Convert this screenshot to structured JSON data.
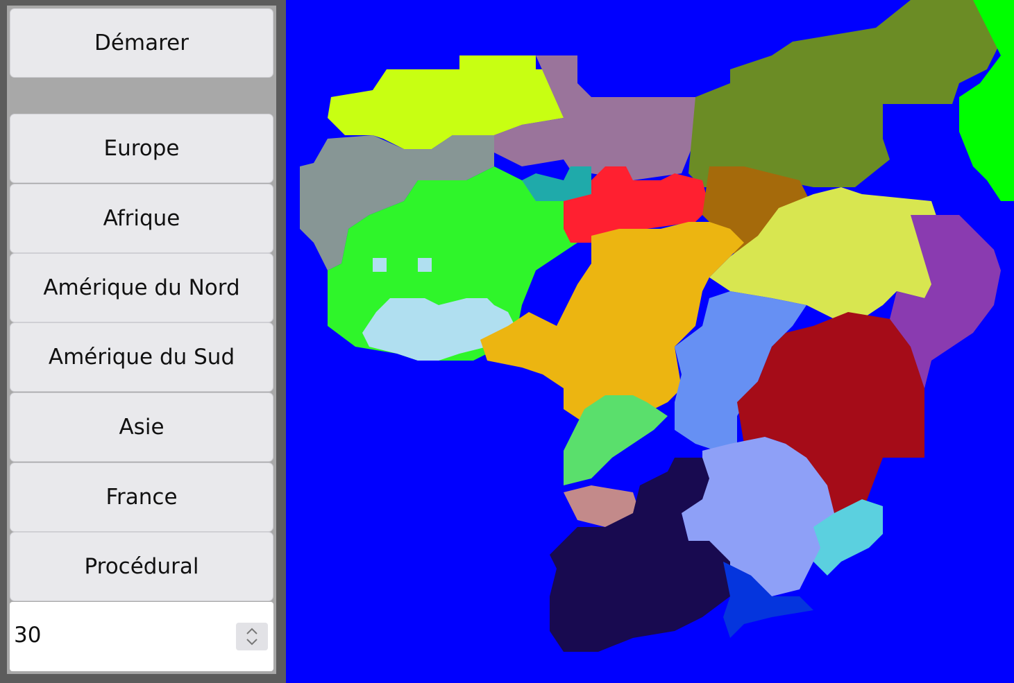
{
  "sidebar": {
    "start_label": "Démarer",
    "buttons": [
      "Europe",
      "Afrique",
      "Amérique du Nord",
      "Amérique du Sud",
      "Asie",
      "France",
      "Procédural"
    ],
    "count_value": "30"
  },
  "map": {
    "ocean_color": "#0000ff",
    "region_colors": [
      "#c8ff12",
      "#9a749b",
      "#6b8c25",
      "#00ff00",
      "#879695",
      "#2ff52a",
      "#b0dff0",
      "#ff2030",
      "#1faaaa",
      "#a56a0b",
      "#d8e650",
      "#8a3bb0",
      "#ecb511",
      "#6690f3",
      "#a50c18",
      "#5adf6c",
      "#c38a8a",
      "#8ea0f7",
      "#180a50",
      "#0535dd",
      "#5bd0df"
    ]
  }
}
